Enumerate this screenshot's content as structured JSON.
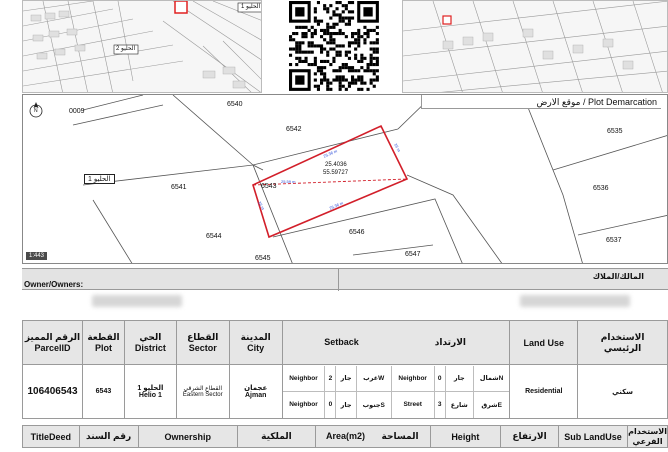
{
  "map_labels": {
    "district_tag_thumb": "الحليو 1",
    "district_tag_thumb2": "الحليو 2",
    "district_tag_plot": "الحليو 1",
    "plot_demarcation": "موقع الارض / Plot Demarcation",
    "scale": "1:443",
    "north": "N",
    "coordinates": "25.4036\n55.59727",
    "coord_lat": "25.4036",
    "coord_lon": "55.59727",
    "plots": [
      "0009",
      "6540",
      "6542",
      "6535",
      "6541",
      "6543",
      "6536",
      "6544",
      "6546",
      "6537",
      "6545",
      "6547"
    ],
    "dims": {
      "top": "25.36 m",
      "right": "16 m",
      "bottom": "25.36 m",
      "left": "16 m",
      "diag": "25.59 m"
    }
  },
  "owners": {
    "label_en": "Owner/Owners:",
    "label_ar": "المالك/الملاك"
  },
  "parcel": {
    "headers": {
      "parcel_id_ar": "الرقم المميز",
      "parcel_id_en": "ParcelID",
      "plot_ar": "القطعة",
      "plot_en": "Plot",
      "district_ar": "الحي",
      "district_en": "District",
      "sector_ar": "القطاع",
      "sector_en": "Sector",
      "city_ar": "المدينة",
      "city_en": "City",
      "setback_en": "Setback",
      "setback_ar": "الارتداد",
      "land_use_en": "Land Use",
      "land_use_ar1": "الاستخدام",
      "land_use_ar2": "الرئيسي"
    },
    "values": {
      "parcel_id": "106406543",
      "plot": "6543",
      "district_ar": "الحليو 1",
      "district_en": "Helio 1",
      "sector_ar": "القطاع الشرقي",
      "sector_en": "Eastern Sector",
      "city_ar": "عجمان",
      "city_en": "Ajman",
      "land_use_en": "Residential",
      "land_use_ar": "سكني"
    },
    "setback": [
      [
        {
          "type_en": "Neighbor",
          "value": "2",
          "type_ar": "جار",
          "dir": "غربW"
        },
        {
          "type_en": "Neighbor",
          "value": "0",
          "type_ar": "جار",
          "dir": "شمالN"
        }
      ],
      [
        {
          "type_en": "Neighbor",
          "value": "0",
          "type_ar": "جار",
          "dir": "جنوبS"
        },
        {
          "type_en": "Street",
          "value": "3",
          "type_ar": "شارع",
          "dir": "شرقE"
        }
      ]
    ],
    "bottom_headers": {
      "title_deed_en": "TitleDeed",
      "title_deed_ar": "رقم السند",
      "ownership_en": "Ownership",
      "ownership_ar": "الملكية",
      "area_en": "Area(m2)",
      "area_ar": "المساحة",
      "height_en": "Height",
      "height_ar": "الارتفاع",
      "sub_land_use_en": "Sub LandUse",
      "sub_land_use_ar1": "الاستخدام",
      "sub_land_use_ar2": "الفرعي"
    }
  }
}
